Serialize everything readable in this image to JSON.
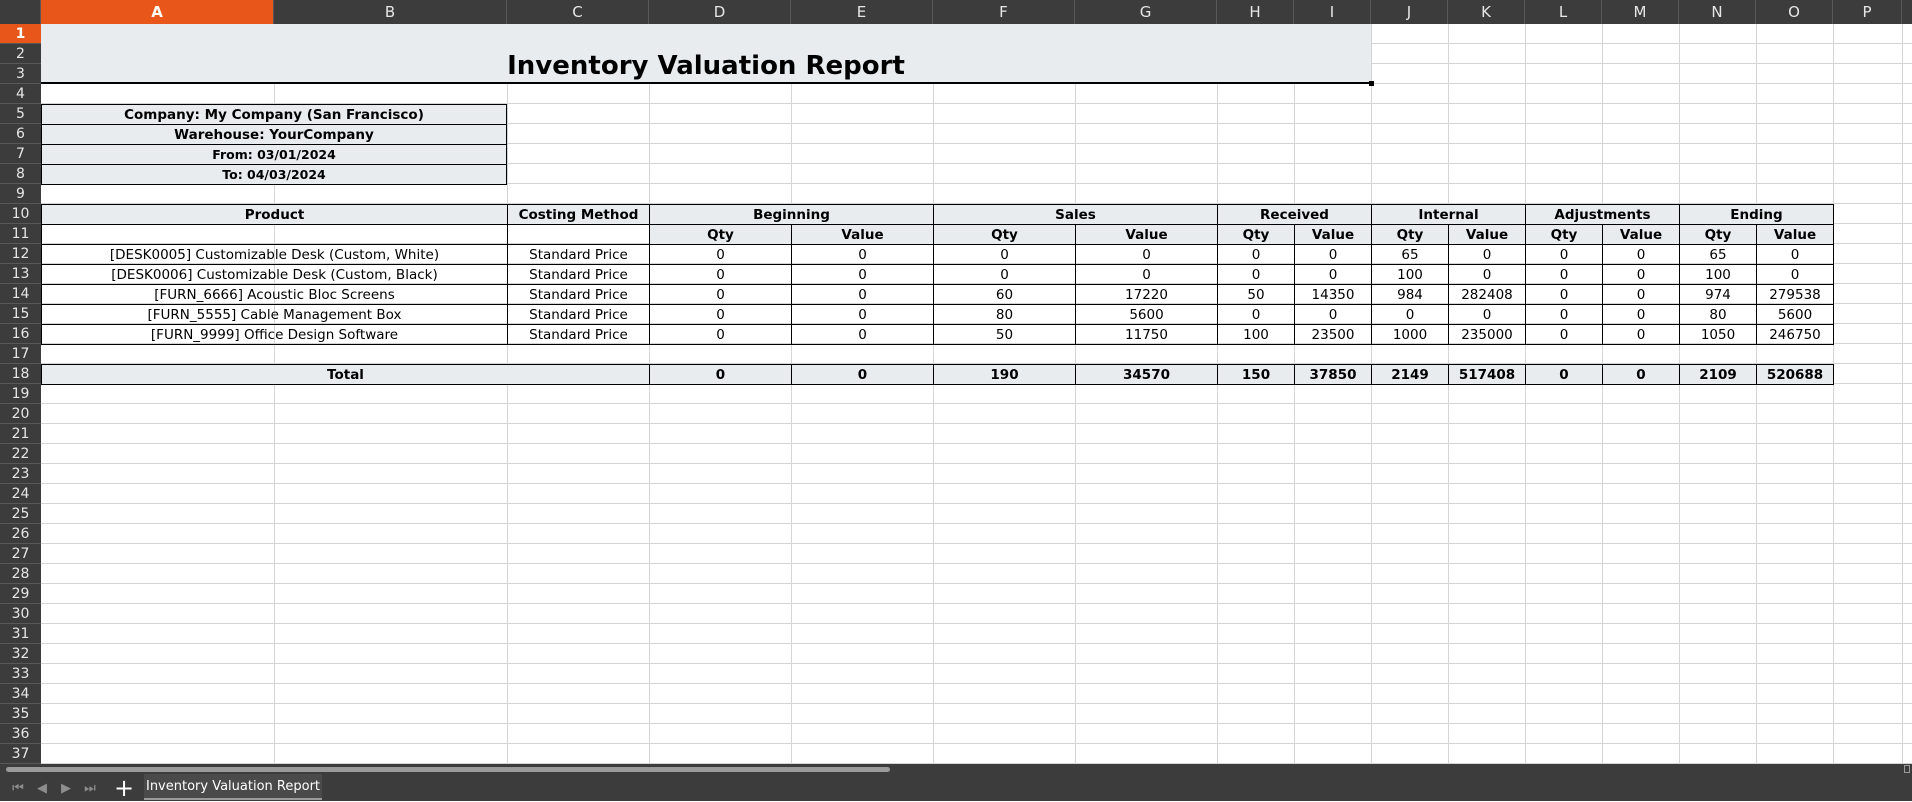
{
  "columns": [
    "A",
    "B",
    "C",
    "D",
    "E",
    "F",
    "G",
    "H",
    "I",
    "J",
    "K",
    "L",
    "M",
    "N",
    "O",
    "P"
  ],
  "rows": [
    "1",
    "2",
    "3",
    "4",
    "5",
    "6",
    "7",
    "8",
    "9",
    "10",
    "11",
    "12",
    "13",
    "14",
    "15",
    "16",
    "17",
    "18",
    "19",
    "20",
    "21",
    "22",
    "23",
    "24",
    "25",
    "26",
    "27",
    "28",
    "29",
    "30",
    "31",
    "32",
    "33",
    "34",
    "35",
    "36",
    "37"
  ],
  "selected": {
    "column": "A",
    "row": "1"
  },
  "report": {
    "title": "Inventory Valuation Report",
    "company": "Company: My Company (San Francisco)",
    "warehouse": "Warehouse: YourCompany",
    "from": "From: 03/01/2024",
    "to": "To: 04/03/2024"
  },
  "table": {
    "product_header": "Product",
    "costing_header": "Costing Method",
    "groups": [
      "Beginning",
      "Sales",
      "Received",
      "Internal",
      "Adjustments",
      "Ending"
    ],
    "qty_label": "Qty",
    "value_label": "Value",
    "rows": [
      {
        "product": "[DESK0005] Customizable Desk (Custom, White)",
        "costing": "Standard Price",
        "values": [
          "0",
          "0",
          "0",
          "0",
          "0",
          "0",
          "65",
          "0",
          "0",
          "0",
          "65",
          "0"
        ]
      },
      {
        "product": "[DESK0006] Customizable Desk (Custom, Black)",
        "costing": "Standard Price",
        "values": [
          "0",
          "0",
          "0",
          "0",
          "0",
          "0",
          "100",
          "0",
          "0",
          "0",
          "100",
          "0"
        ]
      },
      {
        "product": "[FURN_6666] Acoustic Bloc Screens",
        "costing": "Standard Price",
        "values": [
          "0",
          "0",
          "60",
          "17220",
          "50",
          "14350",
          "984",
          "282408",
          "0",
          "0",
          "974",
          "279538"
        ]
      },
      {
        "product": "[FURN_5555] Cable Management Box",
        "costing": "Standard Price",
        "values": [
          "0",
          "0",
          "80",
          "5600",
          "0",
          "0",
          "0",
          "0",
          "0",
          "0",
          "80",
          "5600"
        ]
      },
      {
        "product": "[FURN_9999] Office Design Software",
        "costing": "Standard Price",
        "values": [
          "0",
          "0",
          "50",
          "11750",
          "100",
          "23500",
          "1000",
          "235000",
          "0",
          "0",
          "1050",
          "246750"
        ]
      }
    ],
    "total_label": "Total",
    "totals": [
      "0",
      "0",
      "190",
      "34570",
      "150",
      "37850",
      "2149",
      "517408",
      "0",
      "0",
      "2109",
      "520688"
    ]
  },
  "sheet_tab": "Inventory Valuation Report",
  "icons": {
    "first": "first-sheet-icon",
    "prev": "prev-sheet-icon",
    "next": "next-sheet-icon",
    "last": "last-sheet-icon",
    "add": "add-sheet-icon"
  }
}
